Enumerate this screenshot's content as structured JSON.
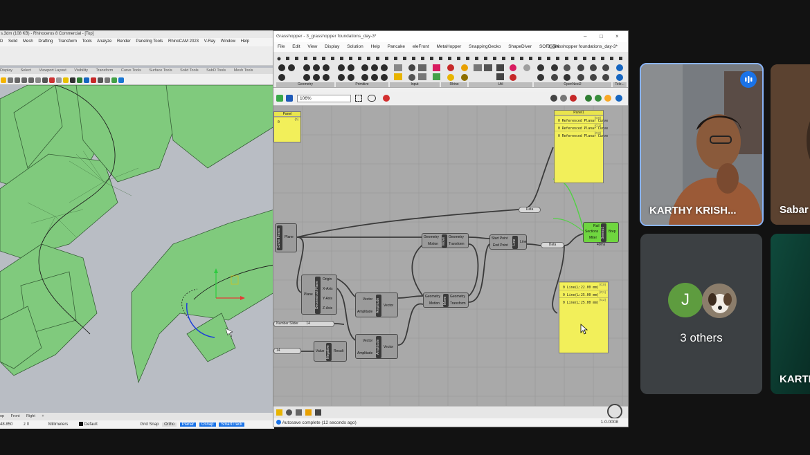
{
  "rhino": {
    "title": "s.3dm (108 KB) - Rhinoceros 8 Commercial - [Top]",
    "menu": [
      "D",
      "Solid",
      "Mesh",
      "Drafting",
      "Transform",
      "Tools",
      "Analyze",
      "Render",
      "Paneling Tools",
      "RhinoCAM 2023",
      "V-Ray",
      "Window",
      "Help"
    ],
    "tabs": [
      "Display",
      "Select",
      "Viewport Layout",
      "Visibility",
      "Transform",
      "Curve Tools",
      "Surface Tools",
      "Solid Tools",
      "SubD Tools",
      "Mesh Tools"
    ],
    "viewport_tabs": [
      "op",
      "Front",
      "Right",
      "+"
    ],
    "status": {
      "coords": "48.850",
      "z": "z 0",
      "units": "Millimeters",
      "layer": "Default",
      "grid_snap": "Grid Snap",
      "ortho": "Ortho",
      "planar": "Planar",
      "osnap": "Osnap",
      "smarttrack": "SmartTrack"
    },
    "colors": {
      "surface": "#7ecb7a",
      "background": "#b9bdc4"
    }
  },
  "grasshopper": {
    "title": "Grasshopper - 3_grasshopper foundations_day-3*",
    "menu": [
      "File",
      "Edit",
      "View",
      "Display",
      "Solution",
      "Help",
      "Pancake",
      "eleFront",
      "MetaHopper",
      "SnappingGecko",
      "ShapeDiver",
      "SOFiSTiK"
    ],
    "doc_tab": "3_grasshopper foundations_day-3*",
    "ribbon_groups": [
      "Geometry",
      "Primitive",
      "Input",
      "Rhino",
      "Util",
      "OpenNest2",
      "Tele..."
    ],
    "zoom": "106%",
    "status": "Autosave complete (12 seconds ago)",
    "version": "1.0.0008",
    "components": {
      "panel_small": {
        "title": "Panel",
        "line": "0",
        "index": "{0}"
      },
      "panel_top": {
        "title": "Panel1",
        "items": [
          {
            "index": "{0;0}",
            "text": "0 Referenced Planar Curve"
          },
          {
            "index": "{0;1}",
            "text": "0 Referenced Planar Curve"
          },
          {
            "index": "{0;2}",
            "text": "0 Referenced Planar Curve"
          }
        ]
      },
      "panel_bottom": {
        "items": [
          {
            "index": "{0;0}",
            "text": "0 Line(L:22.00 mm)"
          },
          {
            "index": "{0;1}",
            "text": "0 Line(L:25.00 mm)"
          },
          {
            "index": "{0;2}",
            "text": "0 Line(L:25.00 mm)"
          }
        ]
      },
      "curve_frame": {
        "name": "Curve Frame",
        "outputs": [
          "Plane"
        ]
      },
      "move_top": {
        "name": "Move",
        "inputs": [
          "Geometry",
          "Motion"
        ],
        "outputs": [
          "Geometry",
          "Transform"
        ]
      },
      "line": {
        "name": "Line",
        "inputs": [
          "Start Point",
          "End Point"
        ],
        "outputs": [
          "Line"
        ]
      },
      "sweep": {
        "name": "Sweep1",
        "inputs": [
          "Rail",
          "Sections",
          "Miter"
        ],
        "outputs": [
          "Brep"
        ],
        "footer": "40ms"
      },
      "deconstruct": {
        "name": "Deconstruct Plane",
        "inputs": [
          "Plane"
        ],
        "outputs": [
          "Origin",
          "X-Axis",
          "Y-Axis",
          "Z-Axis"
        ]
      },
      "amp1": {
        "name": "Amplitude",
        "inputs": [
          "Vector",
          "Amplitude"
        ],
        "outputs": [
          "Vector"
        ]
      },
      "move2": {
        "name": "Move",
        "inputs": [
          "Geometry",
          "Motion"
        ],
        "outputs": [
          "Geometry",
          "Transform"
        ]
      },
      "amp2": {
        "name": "Amplitude",
        "inputs": [
          "Vector",
          "Amplitude"
        ],
        "outputs": [
          "Vector"
        ]
      },
      "negative": {
        "name": "Negative",
        "inputs": [
          "Value"
        ],
        "outputs": [
          "Result"
        ]
      },
      "slider": {
        "label": "Number Slider",
        "value": "14"
      },
      "slider2": {
        "value": "14"
      },
      "relay_data1": "Data",
      "relay_data2": "Data"
    }
  },
  "meeting": {
    "participants": [
      {
        "name": "KARTHY KRISH...",
        "speaking": true
      },
      {
        "name": "Sabar"
      },
      {
        "name": "3 others",
        "avatar_initial": "J",
        "avatar_color": "#5e9c3f"
      },
      {
        "name": "KARTH"
      }
    ]
  }
}
